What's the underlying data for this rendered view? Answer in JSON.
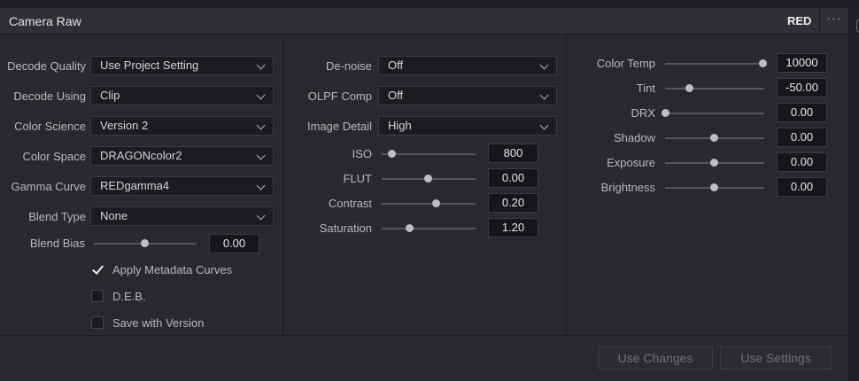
{
  "header": {
    "title": "Camera Raw",
    "badge": "RED",
    "more": "···"
  },
  "col1": {
    "decode_quality": {
      "label": "Decode Quality",
      "value": "Use Project Setting"
    },
    "decode_using": {
      "label": "Decode Using",
      "value": "Clip"
    },
    "color_science": {
      "label": "Color Science",
      "value": "Version 2"
    },
    "color_space": {
      "label": "Color Space",
      "value": "DRAGONcolor2"
    },
    "gamma_curve": {
      "label": "Gamma Curve",
      "value": "REDgamma4"
    },
    "blend_type": {
      "label": "Blend Type",
      "value": "None"
    },
    "blend_bias": {
      "label": "Blend Bias",
      "value": "0.00"
    },
    "apply_metadata_curves": {
      "label": "Apply Metadata Curves",
      "checked": true
    },
    "deb": {
      "label": "D.E.B.",
      "checked": false
    },
    "save_with_version": {
      "label": "Save with Version",
      "checked": false
    }
  },
  "col2": {
    "denoise": {
      "label": "De-noise",
      "value": "Off"
    },
    "olpf_comp": {
      "label": "OLPF Comp",
      "value": "Off"
    },
    "image_detail": {
      "label": "Image Detail",
      "value": "High"
    },
    "iso": {
      "label": "ISO",
      "value": "800"
    },
    "flut": {
      "label": "FLUT",
      "value": "0.00"
    },
    "contrast": {
      "label": "Contrast",
      "value": "0.20"
    },
    "saturation": {
      "label": "Saturation",
      "value": "1.20"
    }
  },
  "col3": {
    "color_temp": {
      "label": "Color Temp",
      "value": "10000"
    },
    "tint": {
      "label": "Tint",
      "value": "-50.00"
    },
    "drx": {
      "label": "DRX",
      "value": "0.00"
    },
    "shadow": {
      "label": "Shadow",
      "value": "0.00"
    },
    "exposure": {
      "label": "Exposure",
      "value": "0.00"
    },
    "brightness": {
      "label": "Brightness",
      "value": "0.00"
    }
  },
  "footer": {
    "use_changes": "Use Changes",
    "use_settings": "Use Settings"
  }
}
